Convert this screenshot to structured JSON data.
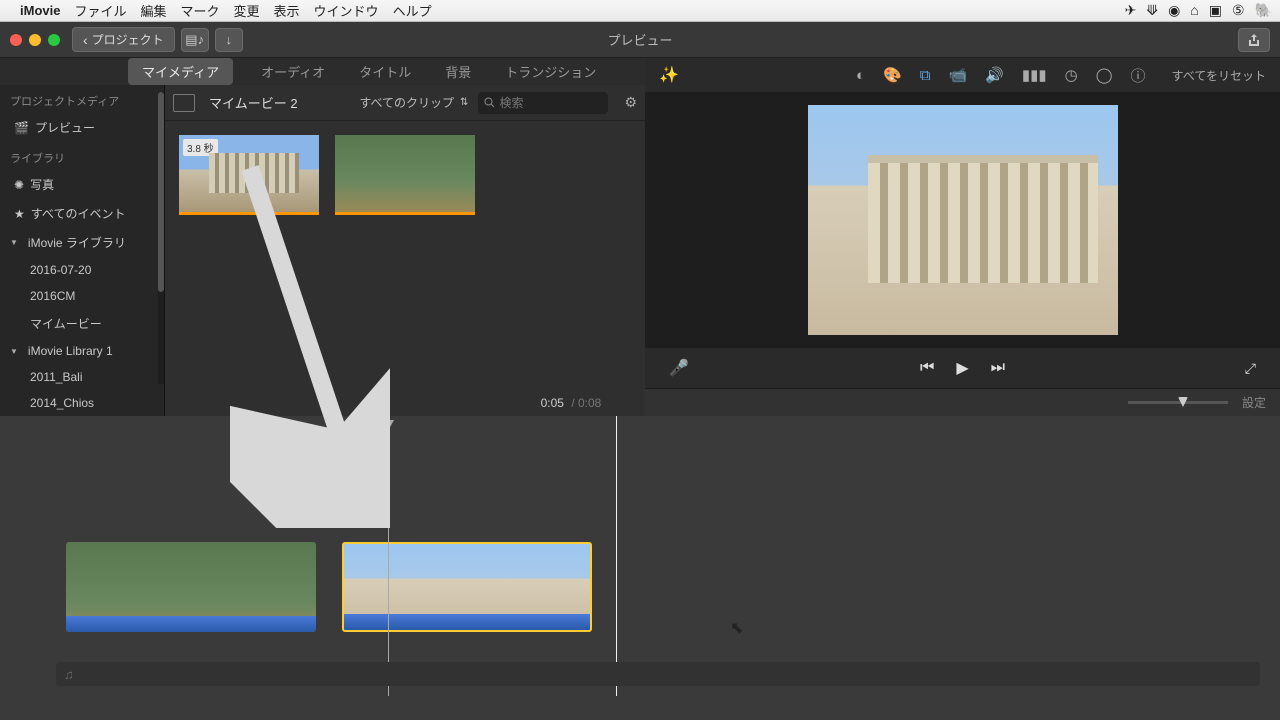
{
  "menubar": {
    "app": "iMovie",
    "items": [
      "ファイル",
      "編集",
      "マーク",
      "変更",
      "表示",
      "ウインドウ",
      "ヘルプ"
    ]
  },
  "titlebar": {
    "back_label": "プロジェクト",
    "title": "プレビュー"
  },
  "tabs": {
    "items": [
      "マイメディア",
      "オーディオ",
      "タイトル",
      "背景",
      "トランジション"
    ],
    "active": 0
  },
  "sidebar": {
    "section1": "プロジェクトメディア",
    "preview": "プレビュー",
    "section2": "ライブラリ",
    "photos": "写真",
    "all_events": "すべてのイベント",
    "lib1": "iMovie ライブラリ",
    "lib1_items": [
      "2016-07-20",
      "2016CM",
      "マイムービー"
    ],
    "lib2": "iMovie Library 1",
    "lib2_items": [
      "2011_Bali",
      "2014_Chios"
    ]
  },
  "contentbar": {
    "title": "マイムービー 2",
    "filter": "すべてのクリップ",
    "search_placeholder": "検索"
  },
  "clip_duration": "3.8 秒",
  "tools": {
    "reset": "すべてをリセット"
  },
  "timebar": {
    "current": "0:05",
    "total": "0:08",
    "settings": "設定"
  }
}
